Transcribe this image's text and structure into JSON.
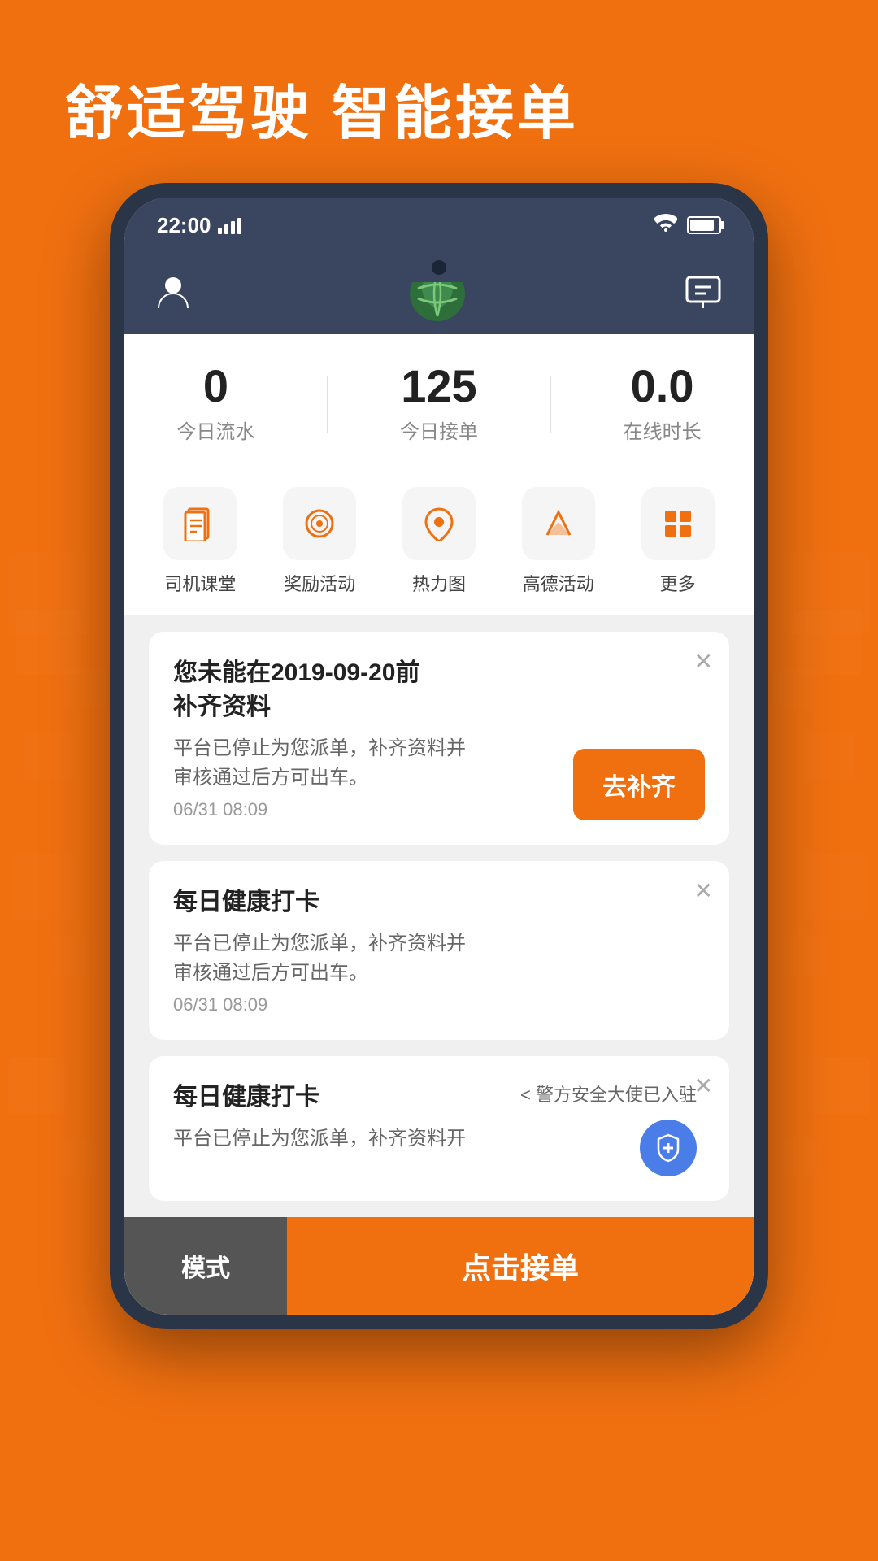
{
  "header": {
    "tagline": "舒适驾驶  智能接单"
  },
  "status_bar": {
    "time": "22:00",
    "signal": "signal",
    "wifi": "wifi",
    "battery": "battery"
  },
  "app_header": {
    "profile_icon": "person",
    "message_icon": "message"
  },
  "stats": {
    "today_flow": {
      "value": "0",
      "label": "今日流水"
    },
    "today_orders": {
      "value": "125",
      "label": "今日接单"
    },
    "online_time": {
      "value": "0.0",
      "label": "在线时长"
    }
  },
  "quick_menu": {
    "items": [
      {
        "label": "司机课堂",
        "icon": "📋"
      },
      {
        "label": "奖励活动",
        "icon": "🎯"
      },
      {
        "label": "热力图",
        "icon": "📍"
      },
      {
        "label": "高德活动",
        "icon": "✈"
      },
      {
        "label": "更多",
        "icon": "⊞"
      }
    ]
  },
  "notifications": [
    {
      "id": "card1",
      "title": "您未能在2019-09-20前\n补齐资料",
      "text": "平台已停止为您派单，补齐资料并\n审核通过后方可出车。",
      "time": "06/31 08:09",
      "action_label": "去补齐",
      "has_action": true
    },
    {
      "id": "card2",
      "title": "每日健康打卡",
      "text": "平台已停止为您派单，补齐资料并\n审核通过后方可出车。",
      "time": "06/31 08:09",
      "has_action": false
    },
    {
      "id": "card3",
      "title": "每日健康打卡",
      "text": "平台已停止为您派单，补齐资料开",
      "has_action": false,
      "police_notice": "< 警方安全大使已入驻"
    }
  ],
  "bottom_bar": {
    "mode_label": "模式",
    "accept_label": "点击接单"
  }
}
